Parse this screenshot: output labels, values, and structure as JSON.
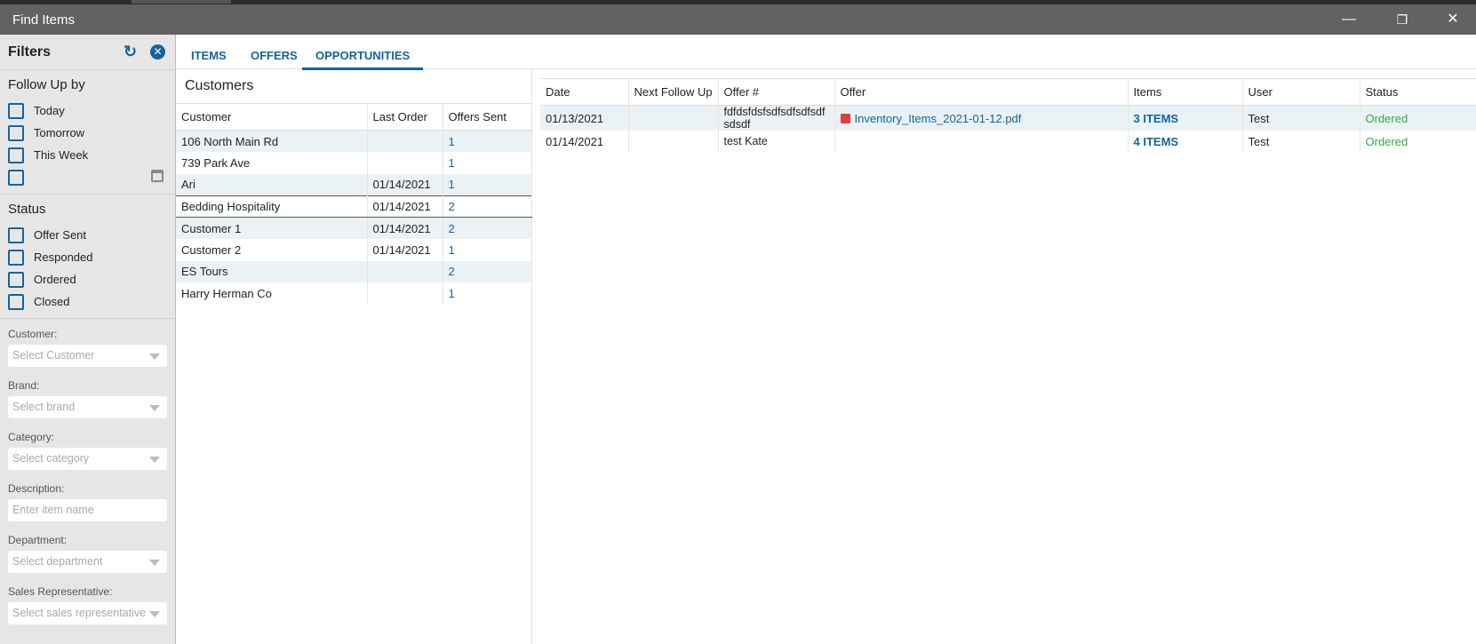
{
  "window": {
    "title": "Find Items",
    "minimize": "—",
    "restore": "❐",
    "close": "✕"
  },
  "sidebar": {
    "title": "Filters",
    "refresh_icon": "↻",
    "clear_icon": "✕",
    "follow_up": {
      "heading": "Follow Up by",
      "options": [
        "Today",
        "Tomorrow",
        "This Week",
        ""
      ]
    },
    "status": {
      "heading": "Status",
      "options": [
        "Offer Sent",
        "Responded",
        "Ordered",
        "Closed"
      ]
    },
    "fields": [
      {
        "label": "Customer:",
        "placeholder": "Select Customer"
      },
      {
        "label": "Brand:",
        "placeholder": "Select brand"
      },
      {
        "label": "Category:",
        "placeholder": "Select category"
      },
      {
        "label": "Description:",
        "placeholder": "Enter item name"
      },
      {
        "label": "Department:",
        "placeholder": "Select department"
      },
      {
        "label": "Sales Representative:",
        "placeholder": "Select sales representative"
      }
    ]
  },
  "tabs": [
    "ITEMS",
    "OFFERS",
    "OPPORTUNITIES"
  ],
  "active_tab": "OPPORTUNITIES",
  "customers": {
    "title": "Customers",
    "columns": [
      "Customer",
      "Last Order",
      "Offers Sent"
    ],
    "rows": [
      [
        "106 North Main Rd",
        "",
        "1"
      ],
      [
        "739 Park Ave",
        "",
        "1"
      ],
      [
        "Ari",
        "01/14/2021",
        "1"
      ],
      [
        "Bedding Hospitality",
        "01/14/2021",
        "2"
      ],
      [
        "Customer 1",
        "01/14/2021",
        "2"
      ],
      [
        "Customer 2",
        "01/14/2021",
        "1"
      ],
      [
        "ES Tours",
        "",
        "2"
      ],
      [
        "Harry Herman Co",
        "",
        "1"
      ]
    ],
    "selected": "Bedding Hospitality"
  },
  "offers": {
    "columns": [
      "Date",
      "Next Follow Up",
      "Offer #",
      "Offer",
      "Items",
      "User",
      "Status"
    ],
    "rows": [
      [
        "01/13/2021",
        "",
        "fdfdsfdsfsdfsdfsdfsdfsdsdf",
        "Inventory_Items_2021-01-12.pdf",
        "3 ITEMS",
        "Test",
        "Ordered"
      ],
      [
        "01/14/2021",
        "",
        "test Kate",
        "",
        "4 ITEMS",
        "Test",
        "Ordered"
      ]
    ]
  },
  "colors": {
    "accent": "#1463a0",
    "status_ordered": "#3aa64a",
    "row_alt": "#eaf2f5",
    "titlebar": "#626262"
  }
}
